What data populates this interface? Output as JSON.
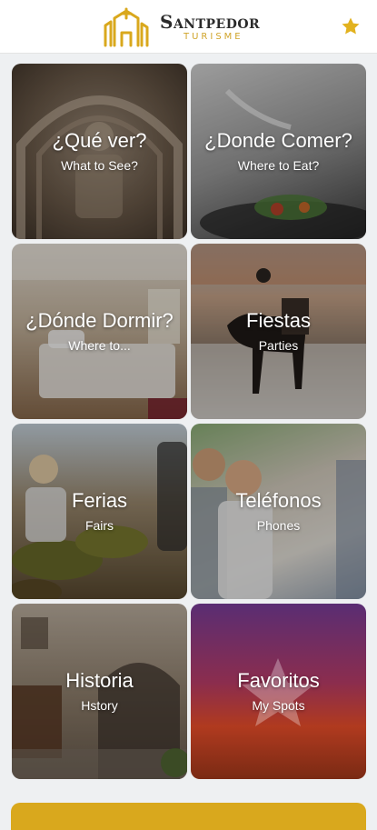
{
  "header": {
    "brand_title": "Santpedor",
    "brand_subtitle": "TURISME",
    "favorite_icon": "star-icon",
    "accent_color": "#e2b21f"
  },
  "tiles": [
    {
      "title": "¿Qué ver?",
      "subtitle": "What to See?"
    },
    {
      "title": "¿Donde Comer?",
      "subtitle": "Where to Eat?"
    },
    {
      "title": "¿Dónde Dormir?",
      "subtitle": "Where to..."
    },
    {
      "title": "Fiestas",
      "subtitle": "Parties"
    },
    {
      "title": "Ferias",
      "subtitle": "Fairs"
    },
    {
      "title": "Teléfonos",
      "subtitle": "Phones"
    },
    {
      "title": "Historia",
      "subtitle": "Hstory"
    },
    {
      "title": "Favoritos",
      "subtitle": "My Spots"
    }
  ],
  "bottom_bar_color": "#d9a81d"
}
